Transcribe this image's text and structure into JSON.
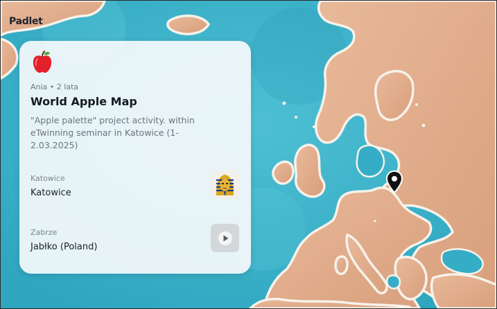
{
  "app": {
    "brand": "Padlet"
  },
  "board": {
    "emoji_icon": "red-apple-icon",
    "author_meta": "Ania • 2 lata",
    "title": "World Apple Map",
    "description": "\"Apple palette\" project activity. within eTwinning seminar in Katowice (1-2.03.2025)"
  },
  "posts": [
    {
      "subject": "Katowice",
      "body": "Katowice",
      "thumbnail_icon": "pharaoh-mask-icon"
    },
    {
      "subject": "Zabrze",
      "body": "Jabłko (Poland)",
      "thumbnail_icon": "play-video-icon"
    }
  ],
  "map": {
    "marker_icon": "map-pin-icon",
    "colors": {
      "sea": "#3eb2c9",
      "land": "#e2ad8b",
      "coast": "#f6f2ea",
      "pin": "#111111"
    }
  }
}
